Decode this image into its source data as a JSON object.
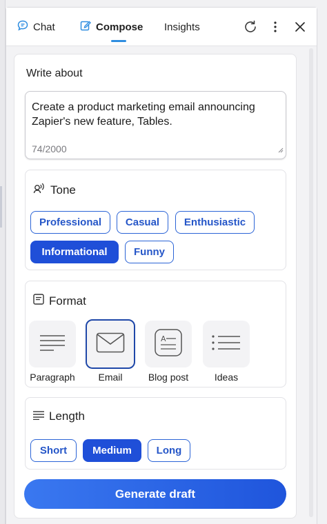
{
  "tabs": [
    {
      "label": "Chat",
      "icon": "chat-bubble-icon"
    },
    {
      "label": "Compose",
      "icon": "compose-icon",
      "active": true
    },
    {
      "label": "Insights"
    }
  ],
  "header_icons": [
    "refresh-icon",
    "more-vertical-icon",
    "close-icon"
  ],
  "write_about": {
    "label": "Write about",
    "value": "Create a product marketing email announcing Zapier's new feature, Tables.",
    "counter": "74/2000"
  },
  "tone": {
    "title": "Tone",
    "options": [
      "Professional",
      "Casual",
      "Enthusiastic",
      "Informational",
      "Funny"
    ],
    "selected": "Informational"
  },
  "format": {
    "title": "Format",
    "options": [
      "Paragraph",
      "Email",
      "Blog post",
      "Ideas"
    ],
    "selected": "Email"
  },
  "length": {
    "title": "Length",
    "options": [
      "Short",
      "Medium",
      "Long"
    ],
    "selected": "Medium"
  },
  "generate_label": "Generate draft",
  "colors": {
    "accent": "#1f4fd8",
    "tab_underline": "#2f8de0",
    "chat_icon": "#2f8de0"
  }
}
